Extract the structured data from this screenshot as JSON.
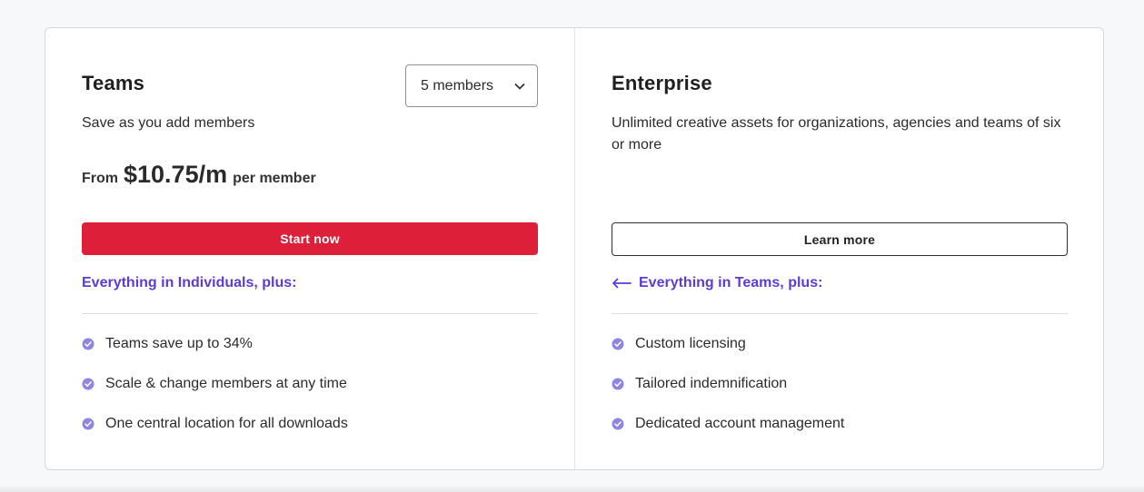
{
  "colors": {
    "accent_purple": "#5a3dd8",
    "primary_red": "#dd1f3a",
    "check_purple": "#8f86e0"
  },
  "teams": {
    "title": "Teams",
    "description": "Save as you add members",
    "members_select": {
      "value": "5 members",
      "icon": "chevron-down-icon"
    },
    "price": {
      "from": "From",
      "amount": "$10.75/m",
      "unit": "per member"
    },
    "cta_label": "Start now",
    "includes_label": "Everything in Individuals, plus:",
    "features": [
      "Teams save up to 34%",
      "Scale & change members at any time",
      "One central location for all downloads"
    ]
  },
  "enterprise": {
    "title": "Enterprise",
    "description": "Unlimited creative assets for organizations, agencies and teams of six or more",
    "cta_label": "Learn more",
    "includes_icon": "arrow-left-icon",
    "includes_label": "Everything in Teams, plus:",
    "features": [
      "Custom licensing",
      "Tailored indemnification",
      "Dedicated account management"
    ]
  }
}
